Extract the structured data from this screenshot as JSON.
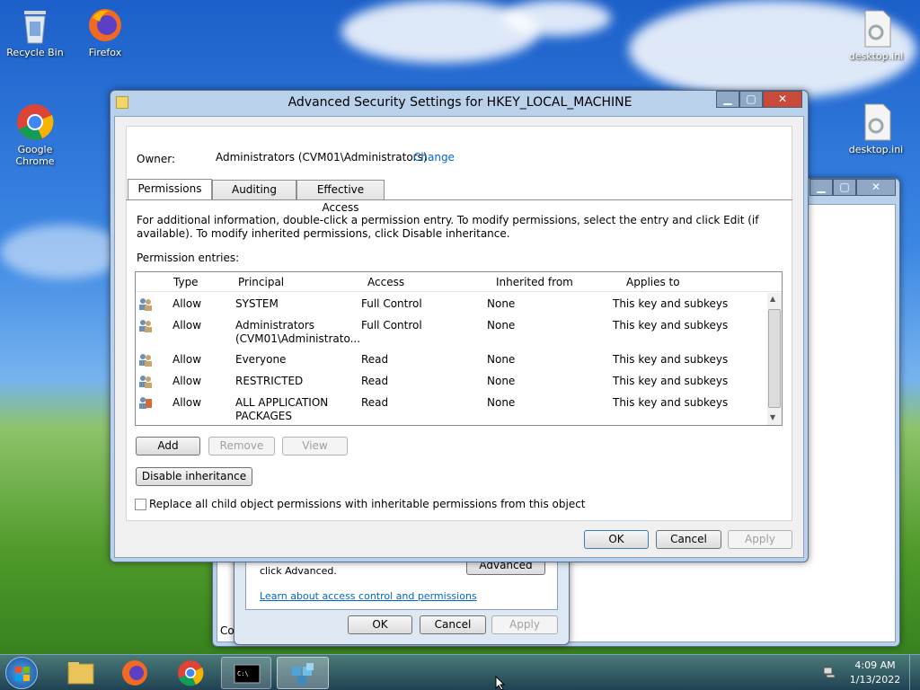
{
  "desktop": {
    "icons": [
      {
        "label": "Recycle Bin"
      },
      {
        "label": "Firefox"
      },
      {
        "label": "Google Chrome"
      },
      {
        "label": "desktop.ini"
      },
      {
        "label": "desktop.ini"
      }
    ]
  },
  "dialog": {
    "title": "Advanced Security Settings for HKEY_LOCAL_MACHINE",
    "owner_label": "Owner:",
    "owner_value": "Administrators (CVM01\\Administrators)",
    "change_link": "Change",
    "tabs": [
      {
        "label": "Permissions"
      },
      {
        "label": "Auditing"
      },
      {
        "label": "Effective Access"
      }
    ],
    "info_text": "For additional information, double-click a permission entry. To modify permissions, select the entry and click Edit (if available). To modify inherited permissions, click Disable inheritance.",
    "entries_label": "Permission entries:",
    "columns": [
      "Type",
      "Principal",
      "Access",
      "Inherited from",
      "Applies to"
    ],
    "entries": [
      {
        "type": "Allow",
        "principal": "SYSTEM",
        "access": "Full Control",
        "inherited": "None",
        "applies": "This key and subkeys"
      },
      {
        "type": "Allow",
        "principal": "Administrators (CVM01\\Administrato...",
        "access": "Full Control",
        "inherited": "None",
        "applies": "This key and subkeys"
      },
      {
        "type": "Allow",
        "principal": "Everyone",
        "access": "Read",
        "inherited": "None",
        "applies": "This key and subkeys"
      },
      {
        "type": "Allow",
        "principal": "RESTRICTED",
        "access": "Read",
        "inherited": "None",
        "applies": "This key and subkeys"
      },
      {
        "type": "Allow",
        "principal": "ALL APPLICATION PACKAGES",
        "access": "Read",
        "inherited": "None",
        "applies": "This key and subkeys"
      }
    ],
    "add_label": "Add",
    "remove_label": "Remove",
    "view_label": "View",
    "disable_inheritance_label": "Disable inheritance",
    "replace_checkbox_label": "Replace all child object permissions with inheritable permissions from this object",
    "ok_label": "OK",
    "cancel_label": "Cancel",
    "apply_label": "Apply"
  },
  "back_dialog": {
    "partial_text": "click Advanced.",
    "advanced_label": "Advanced",
    "learn_link": "Learn about access control and permissions",
    "ok_label": "OK",
    "cancel_label": "Cancel",
    "apply_label": "Apply",
    "partial_left": "Co"
  },
  "taskbar": {
    "time": "4:09 AM",
    "date": "1/13/2022"
  }
}
